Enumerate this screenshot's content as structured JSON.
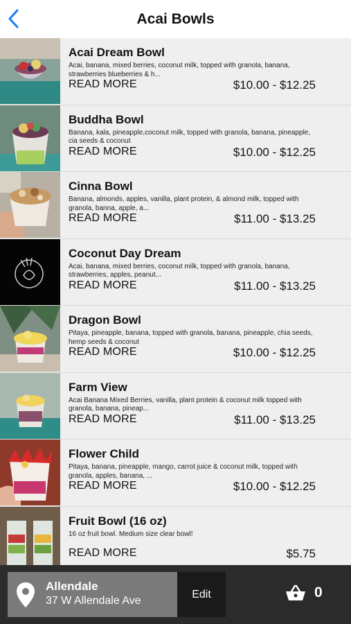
{
  "header": {
    "title": "Acai Bowls"
  },
  "colors": {
    "accent": "#1a7cf5",
    "footer_bg": "#2b2b2b",
    "location_bg": "#7a7a7a",
    "edit_bg": "#1a1a1a"
  },
  "items": [
    {
      "name": "Acai Dream Bowl",
      "desc": "Acai, banana, mixed berries, coconut milk, topped with granola, banana, strawberries blueberries & h...",
      "more": "READ MORE",
      "price": "$10.00 - $12.25"
    },
    {
      "name": "Buddha Bowl",
      "desc": "Banana, kala, pineapple,coconut milk, topped with granola, banana, pineapple, cia seeds & coconut",
      "more": "READ MORE",
      "price": "$10.00 - $12.25"
    },
    {
      "name": "Cinna Bowl",
      "desc": "Banana, almonds, apples, vanilla, plant protein, & almond milk, topped with granola, banna, apple, a...",
      "more": "READ MORE",
      "price": "$11.00 - $13.25"
    },
    {
      "name": "Coconut Day Dream",
      "desc": "Acai, banana, mixed berries, coconut milk, topped with granola, banana, strawberries, apples, peanut...",
      "more": "READ MORE",
      "price": "$11.00 - $13.25"
    },
    {
      "name": "Dragon Bowl",
      "desc": "Pitaya, pineapple, banana, topped with granola, banana, pineapple, chia seeds, hemp seeds & coconut",
      "more": "READ MORE",
      "price": "$10.00 - $12.25"
    },
    {
      "name": "Farm View",
      "desc": "Acai Banana Mixed Berries, vanilla, plant protein & coconut milk topped with granola, banana, pineap...",
      "more": "READ MORE",
      "price": "$11.00 - $13.25"
    },
    {
      "name": "Flower Child",
      "desc": "Pitaya, banana, pineapple, mango, carrot juice & coconut milk, topped with granola, apples, banana, ...",
      "more": "READ MORE",
      "price": "$10.00 - $12.25"
    },
    {
      "name": "Fruit Bowl (16 oz)",
      "desc": "16 oz fruit bowl. Medium size clear bowl!",
      "more": "READ MORE",
      "price": "$5.75"
    }
  ],
  "footer": {
    "location_name": "Allendale",
    "location_address": "37 W Allendale Ave",
    "edit_label": "Edit",
    "cart_count": "0"
  }
}
